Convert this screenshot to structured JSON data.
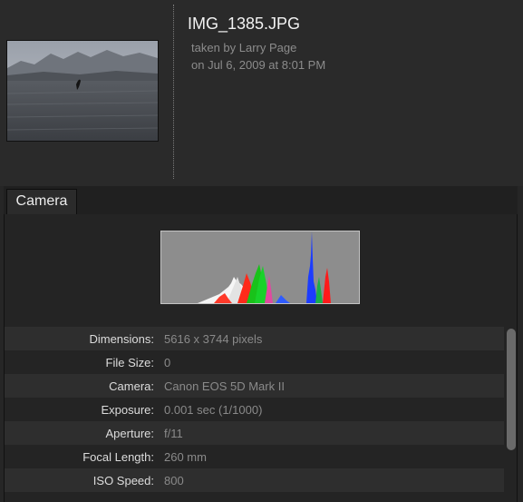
{
  "photo": {
    "filename": "IMG_1385.JPG",
    "taken_by": "taken by Larry Page",
    "taken_on": "on Jul 6, 2009 at 8:01 PM"
  },
  "tabs": [
    {
      "label": "Camera"
    }
  ],
  "exif": [
    {
      "label": "Dimensions:",
      "value": "5616 x 3744 pixels"
    },
    {
      "label": "File Size:",
      "value": "0"
    },
    {
      "label": "Camera:",
      "value": "Canon EOS 5D Mark II"
    },
    {
      "label": "Exposure:",
      "value": "0.001 sec (1/1000)"
    },
    {
      "label": "Aperture:",
      "value": "f/11"
    },
    {
      "label": "Focal Length:",
      "value": "260 mm"
    },
    {
      "label": "ISO Speed:",
      "value": "800"
    }
  ]
}
